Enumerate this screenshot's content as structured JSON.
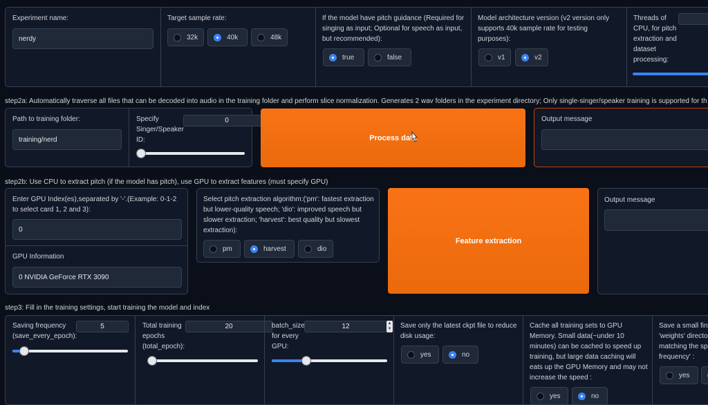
{
  "top": {
    "experiment": {
      "label": "Experiment name:",
      "value": "nerdy"
    },
    "sample_rate": {
      "label": "Target sample rate:",
      "options": [
        "32k",
        "40k",
        "48k"
      ],
      "selected": "40k"
    },
    "pitch": {
      "label": "If the model have pitch guidance (Required for singing as input; Optional for speech as input, but recommended):",
      "options": [
        "true",
        "false"
      ],
      "selected": "true"
    },
    "version": {
      "label": "Model architecture version (v2 version only supports 40k sample rate for testing purposes):",
      "options": [
        "v1",
        "v2"
      ],
      "selected": "v2"
    },
    "threads": {
      "label": "Threads of CPU, for pitch extraction and dataset processing:"
    }
  },
  "step2a": {
    "heading": "step2a: Automatically traverse all files that can be decoded into audio in the training folder and perform slice normalization. Generates 2 wav folders in the experiment directory; Only single-singer/speaker training is supported for th",
    "path": {
      "label": "Path to training folder:",
      "value": "training/nerd"
    },
    "speaker": {
      "label": "Specify Singer/Speaker ID:",
      "value": "0",
      "slider_fraction": 0
    },
    "process_button": "Process data",
    "output": {
      "label": "Output message"
    }
  },
  "step2b": {
    "heading": "step2b: Use CPU to extract pitch (if the model has pitch), use GPU to extract features (must specify GPU)",
    "gpu_index": {
      "label": "Enter GPU Index(es),separated by '-'.(Example: 0-1-2 to select card 1, 2 and 3):",
      "value": "0"
    },
    "gpu_info": {
      "label": "GPU Information",
      "value": "0 NVIDIA GeForce RTX 3090"
    },
    "f0": {
      "label": "Select pitch extraction algorithm:('pm': fastest extraction but lower-quality speech; 'dio': improved speech but slower extraction; 'harvest': best quality but slowest extraction):",
      "options": [
        "pm",
        "harvest",
        "dio"
      ],
      "selected": "harvest"
    },
    "feature_button": "Feature extraction",
    "output": {
      "label": "Output message"
    }
  },
  "step3": {
    "heading": "step3: Fill in the training settings, start training the model and index",
    "save_freq": {
      "label": "Saving frequency (save_every_epoch):",
      "value": "5",
      "slider_fraction": 0.1
    },
    "total_epoch": {
      "label": "Total training epochs (total_epoch):",
      "value": "20",
      "slider_fraction": 0.03
    },
    "batch_size": {
      "label": "batch_size for every GPU:",
      "value": "12",
      "slider_fraction": 0.3
    },
    "save_latest": {
      "label": "Save only the latest ckpt file to reduce disk usage:",
      "options": [
        "yes",
        "no"
      ],
      "selected": "no"
    },
    "cache": {
      "label": "Cache all training sets to GPU Memory. Small data(~under 10 minutes) can be cached to speed up training, but large data caching will eats up the GPU Memory and may not increase the speed :",
      "options": [
        "yes",
        "no"
      ],
      "selected": "no"
    },
    "save_small": {
      "label": "Save a small fini 'weights' directo matching the spe frequency' :",
      "options": [
        "yes"
      ],
      "selected": "yes"
    }
  },
  "colors": {
    "accent": "#3b82f6",
    "button": "#f97316",
    "background": "#0b0f19"
  }
}
